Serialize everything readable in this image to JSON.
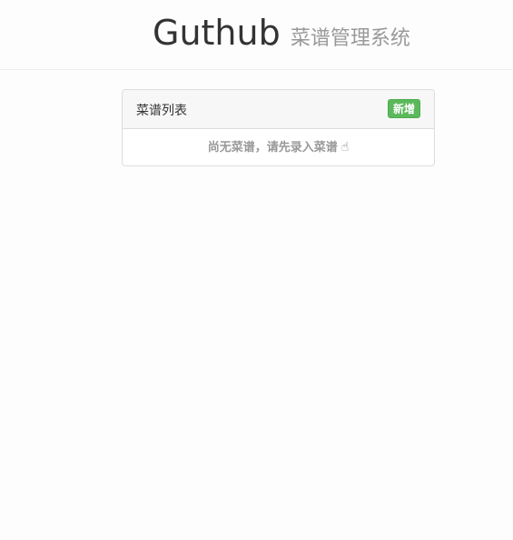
{
  "header": {
    "brand": "Guthub",
    "subtitle": "菜谱管理系统"
  },
  "panel": {
    "title": "菜谱列表",
    "add_button": "新增",
    "empty_message": "尚无菜谱，请先录入菜谱",
    "empty_icon": "pointing-hand-icon"
  },
  "colors": {
    "accent_green": "#5cb85c",
    "muted_text": "#999999"
  }
}
